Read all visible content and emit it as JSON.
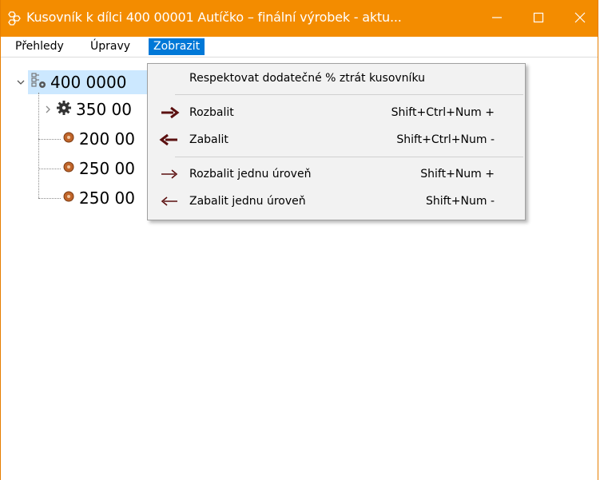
{
  "window": {
    "title": "Kusovník k dílci 400 00001 Autíčko – finální výrobek - aktu...",
    "accent_color": "#f38c00",
    "title_icon": "bom-tree-icon",
    "controls": {
      "minimize_icon": "minimize-icon",
      "maximize_icon": "maximize-icon",
      "close_icon": "close-icon"
    }
  },
  "menubar": {
    "items": [
      {
        "label": "Přehledy"
      },
      {
        "label": "Úpravy"
      },
      {
        "label": "Zobrazit",
        "active": true
      }
    ]
  },
  "tree": {
    "nodes": [
      {
        "label": "400 0000",
        "icon": "assembly-gear-icon",
        "selected": true,
        "expanded": true
      },
      {
        "label": "350 00",
        "icon": "gear-icon",
        "collapsed": true
      },
      {
        "label": "200 00",
        "icon": "part-icon"
      },
      {
        "label": "250 00",
        "icon": "part-icon"
      },
      {
        "label": "250 00",
        "icon": "part-icon"
      }
    ]
  },
  "dropdown": {
    "items": [
      {
        "label": "Respektovat dodatečné % ztrát kusovníku",
        "shortcut": "",
        "icon": ""
      },
      {
        "label": "Rozbalit",
        "shortcut": "Shift+Ctrl+Num +",
        "icon": "bold-arrow-right-icon"
      },
      {
        "label": "Zabalit",
        "shortcut": "Shift+Ctrl+Num -",
        "icon": "bold-arrow-left-icon"
      },
      {
        "label": "Rozbalit jednu úroveň",
        "shortcut": "Shift+Num +",
        "icon": "arrow-right-icon"
      },
      {
        "label": "Zabalit jednu úroveň",
        "shortcut": "Shift+Num -",
        "icon": "arrow-left-icon"
      }
    ]
  }
}
